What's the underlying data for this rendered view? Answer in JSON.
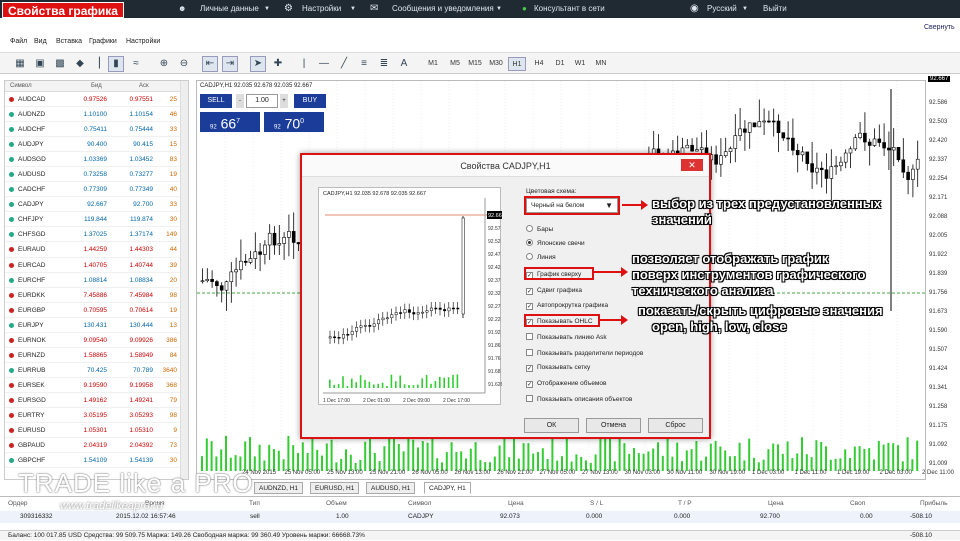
{
  "slide_title": "Свойства графика",
  "topbar": {
    "personal": "Личные данные",
    "settings": "Настройки",
    "messages": "Сообщения и уведомления",
    "consultant": "Консультант в сети",
    "language": "Русский",
    "logout": "Выйти",
    "collapse": "Свернуть"
  },
  "menu": [
    "Файл",
    "Вид",
    "Вставка",
    "Графики",
    "Настройки"
  ],
  "timeframes": [
    "M1",
    "M5",
    "M15",
    "M30",
    "H1",
    "H4",
    "D1",
    "W1",
    "MN"
  ],
  "active_timeframe": "H1",
  "market": {
    "headers": {
      "symbol": "Символ",
      "bid": "Бид",
      "ask": "Аск"
    },
    "rows": [
      {
        "s": "AUDCAD",
        "b": "0.97526",
        "a": "0.97551",
        "p": "25",
        "d": "up"
      },
      {
        "s": "AUDNZD",
        "b": "1.10100",
        "a": "1.10154",
        "p": "46",
        "d": "dn"
      },
      {
        "s": "AUDCHF",
        "b": "0.75411",
        "a": "0.75444",
        "p": "33",
        "d": "dn"
      },
      {
        "s": "AUDJPY",
        "b": "90.400",
        "a": "90.415",
        "p": "15",
        "d": "dn"
      },
      {
        "s": "AUDSGD",
        "b": "1.03369",
        "a": "1.03452",
        "p": "83",
        "d": "dn"
      },
      {
        "s": "AUDUSD",
        "b": "0.73258",
        "a": "0.73277",
        "p": "19",
        "d": "dn"
      },
      {
        "s": "CADCHF",
        "b": "0.77309",
        "a": "0.77349",
        "p": "40",
        "d": "dn"
      },
      {
        "s": "CADJPY",
        "b": "92.667",
        "a": "92.700",
        "p": "33",
        "d": "dn"
      },
      {
        "s": "CHFJPY",
        "b": "119.844",
        "a": "119.874",
        "p": "30",
        "d": "dn"
      },
      {
        "s": "CHFSGD",
        "b": "1.37025",
        "a": "1.37174",
        "p": "149",
        "d": "dn"
      },
      {
        "s": "EURAUD",
        "b": "1.44259",
        "a": "1.44303",
        "p": "44",
        "d": "up"
      },
      {
        "s": "EURCAD",
        "b": "1.40705",
        "a": "1.40744",
        "p": "39",
        "d": "up"
      },
      {
        "s": "EURCHF",
        "b": "1.08814",
        "a": "1.08834",
        "p": "20",
        "d": "dn"
      },
      {
        "s": "EURDKK",
        "b": "7.45886",
        "a": "7.45984",
        "p": "98",
        "d": "up"
      },
      {
        "s": "EURGBP",
        "b": "0.70595",
        "a": "0.70614",
        "p": "19",
        "d": "up"
      },
      {
        "s": "EURJPY",
        "b": "130.431",
        "a": "130.444",
        "p": "13",
        "d": "dn"
      },
      {
        "s": "EURNOK",
        "b": "9.09540",
        "a": "9.09926",
        "p": "386",
        "d": "up"
      },
      {
        "s": "EURNZD",
        "b": "1.58865",
        "a": "1.58949",
        "p": "84",
        "d": "up"
      },
      {
        "s": "EURRUB",
        "b": "70.425",
        "a": "70.789",
        "p": "3640",
        "d": "dn"
      },
      {
        "s": "EURSEK",
        "b": "9.19590",
        "a": "9.19958",
        "p": "368",
        "d": "up"
      },
      {
        "s": "EURSGD",
        "b": "1.49162",
        "a": "1.49241",
        "p": "79",
        "d": "up"
      },
      {
        "s": "EURTRY",
        "b": "3.05195",
        "a": "3.05293",
        "p": "98",
        "d": "up"
      },
      {
        "s": "EURUSD",
        "b": "1.05301",
        "a": "1.05310",
        "p": "9",
        "d": "up"
      },
      {
        "s": "GBPAUD",
        "b": "2.04319",
        "a": "2.04392",
        "p": "73",
        "d": "up"
      },
      {
        "s": "GBPCHF",
        "b": "1.54109",
        "a": "1.54139",
        "p": "30",
        "d": "dn"
      }
    ]
  },
  "chart": {
    "header": "CADJPY,H1  92.035 92.678 92.035 92.667",
    "last_price": "92.667",
    "price_ticks": [
      "92.586",
      "92.503",
      "92.420",
      "92.337",
      "92.254",
      "92.171",
      "92.088",
      "92.005",
      "91.922",
      "91.839",
      "91.756",
      "91.673",
      "91.590",
      "91.507",
      "91.424",
      "91.341",
      "91.258",
      "91.175",
      "91.092",
      "91.009"
    ],
    "time_ticks": [
      "24 Nov 2015",
      "25 Nov 05:00",
      "25 Nov 13:00",
      "25 Nov 21:00",
      "26 Nov 05:00",
      "26 Nov 13:00",
      "26 Nov 21:00",
      "27 Nov 05:00",
      "27 Nov 13:00",
      "30 Nov 03:00",
      "30 Nov 11:00",
      "30 Nov 19:00",
      "1 Dec 03:00",
      "1 Dec 11:00",
      "1 Dec 19:00",
      "2 Dec 03:00",
      "2 Dec 11:00"
    ],
    "tabs": [
      "AUDNZD, H1",
      "EURUSD, H1",
      "AUDUSD, H1",
      "CADJPY, H1"
    ],
    "active_tab": "CADJPY, H1"
  },
  "trade_panel": {
    "sell": "SELL",
    "buy": "BUY",
    "lot": "1.00",
    "sell_price_small": "92",
    "sell_price_big": "66",
    "sell_price_sup": "7",
    "buy_price_small": "92",
    "buy_price_big": "70",
    "buy_price_sup": "0"
  },
  "dialog": {
    "title": "Свойства CADJPY,H1",
    "preview_header": "CADJPY,H1  92.035 92.678 92.035 92.667",
    "preview_price": "92.667",
    "preview_ticks": [
      "92.57",
      "92.52",
      "92.47",
      "92.42",
      "92.37",
      "92.32",
      "92.27",
      "92.22",
      "91.92",
      "91.86",
      "91.76",
      "91.68",
      "91.626"
    ],
    "preview_times": [
      "1 Dec 17:00",
      "2 Dec 01:00",
      "2 Dec 09:00",
      "2 Dec 17:00"
    ],
    "scheme_label": "Цветовая схема:",
    "scheme_value": "Черный на белом",
    "radios": [
      {
        "label": "Бары",
        "on": false
      },
      {
        "label": "Японские свечи",
        "on": true
      },
      {
        "label": "Линия",
        "on": false
      }
    ],
    "checks": [
      {
        "label": "График сверху",
        "on": true
      },
      {
        "label": "Сдвиг графика",
        "on": true
      },
      {
        "label": "Автопрокрутка графика",
        "on": true
      },
      {
        "label": "Показывать OHLC",
        "on": true
      },
      {
        "label": "Показывать линию Ask",
        "on": false
      },
      {
        "label": "Показывать разделители периодов",
        "on": false
      },
      {
        "label": "Показывать сетку",
        "on": true
      },
      {
        "label": "Отображение объемов",
        "on": true
      },
      {
        "label": "Показывать описания объектов",
        "on": false
      }
    ],
    "ok": "ОК",
    "cancel": "Отмена",
    "reset": "Сброс"
  },
  "annotations": {
    "a1": "выбор из трех предустановленных",
    "a1b": "значений",
    "a2": "позволяет отображать график",
    "a2b": "поверх инструментов графического",
    "a2c": "технического анализа",
    "a3": "показать/скрыть цифровые значения",
    "a3b": "open, high, low, close"
  },
  "watermark": {
    "brand": "TRADE like a PRO",
    "url": "www.tradelikeapro.ru"
  },
  "trade": {
    "headers": [
      "Ордер",
      "Время",
      "Тип",
      "Объем",
      "Символ",
      "Цена",
      "S / L",
      "T / P",
      "Цена",
      "Своп",
      "Прибыль"
    ],
    "row": [
      "309316332",
      "2015.12.02 16:57:46",
      "sell",
      "1.00",
      "CADJPY",
      "92.073",
      "0.000",
      "0.000",
      "92.700",
      "0.00",
      "-508.10"
    ],
    "balance": "Баланс: 100 017.85 USD  Средства: 99 509.75  Маржа: 149.26  Свободная маржа: 99 360.49  Уровень маржи: 66668.73%",
    "total": "-508.10"
  }
}
